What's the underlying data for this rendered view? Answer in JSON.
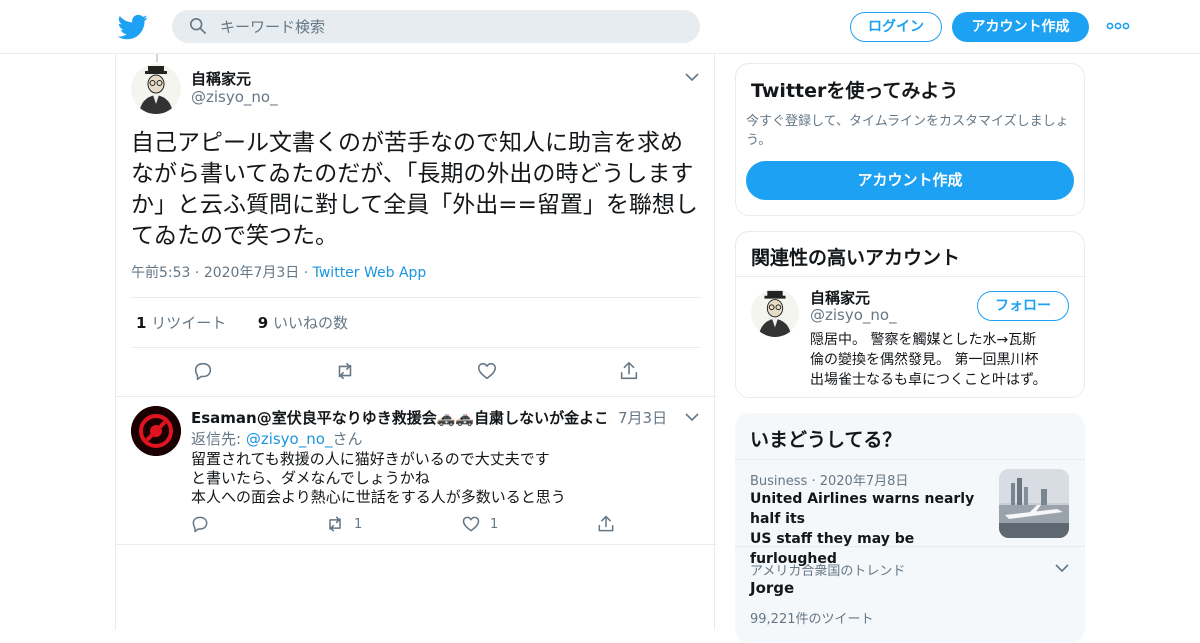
{
  "header": {
    "search_placeholder": "キーワード検索",
    "login_label": "ログイン",
    "signup_label": "アカウント作成"
  },
  "tweet": {
    "author_name": "自稱家元",
    "author_handle": "@zisyo_no_",
    "text": "自己アピール文書くのが苦手なので知人に助言を求めながら書いてゐたのだが、「長期の外出の時どうしますか」と云ふ質問に對して全員「外出==留置」を聯想してゐたので笑つた。",
    "time": "午前5:53",
    "date": "2020年7月3日",
    "source": "Twitter Web App",
    "retweet_count": "1",
    "retweet_label": "リツイート",
    "like_count": "9",
    "like_label": "いいねの数"
  },
  "reply": {
    "author_name": "Esaman@室伏良平なりゆき救援会🚓🚓自粛しないが金よこ…",
    "date": "7月3日",
    "reply_to_prefix": "返信先: ",
    "reply_to_handle": "@zisyo_no_",
    "reply_to_suffix": "さん",
    "line1": "留置されても救援の人に猫好きがいるので大丈夫です",
    "line2": "と書いたら、ダメなんでしょうかね",
    "line3": "本人への面会より熱心に世話をする人が多数いると思う",
    "retweet_count": "1",
    "like_count": "1"
  },
  "signup_card": {
    "title": "Twitterを使ってみよう",
    "description_line1": "今すぐ登録して、タイムラインをカスタマイズしましょ",
    "description_line2": "う。",
    "button_label": "アカウント作成"
  },
  "related_card": {
    "title": "関連性の高いアカウント",
    "name": "自稱家元",
    "handle": "@zisyo_no_",
    "follow_label": "フォロー",
    "bio_line1": "隠居中。 警察を觸媒とした水→瓦斯",
    "bio_line2": "倫の變換を偶然發見。 第一回黒川杯",
    "bio_line3": "出場雀士なるも卓につくこと叶はず。"
  },
  "trends_card": {
    "title": "いまどうしてる？",
    "item1_category": "Business",
    "item1_date": "2020年7月8日",
    "item1_line1": "United Airlines warns nearly half its",
    "item1_line2": "US staff they may be furloughed",
    "item2_context": "アメリカ合衆国のトレンド",
    "item2_name": "Jorge",
    "item2_count": "99,221件のツイート"
  },
  "colors": {
    "accent": "#1da1f2",
    "link": "#1b95e0",
    "secondary_text": "#657786",
    "border": "#e6ecf0"
  },
  "icons": [
    "twitter-bird-icon",
    "search-icon",
    "more-icon",
    "chevron-down-icon",
    "reply-icon",
    "retweet-icon",
    "like-icon",
    "share-icon"
  ]
}
